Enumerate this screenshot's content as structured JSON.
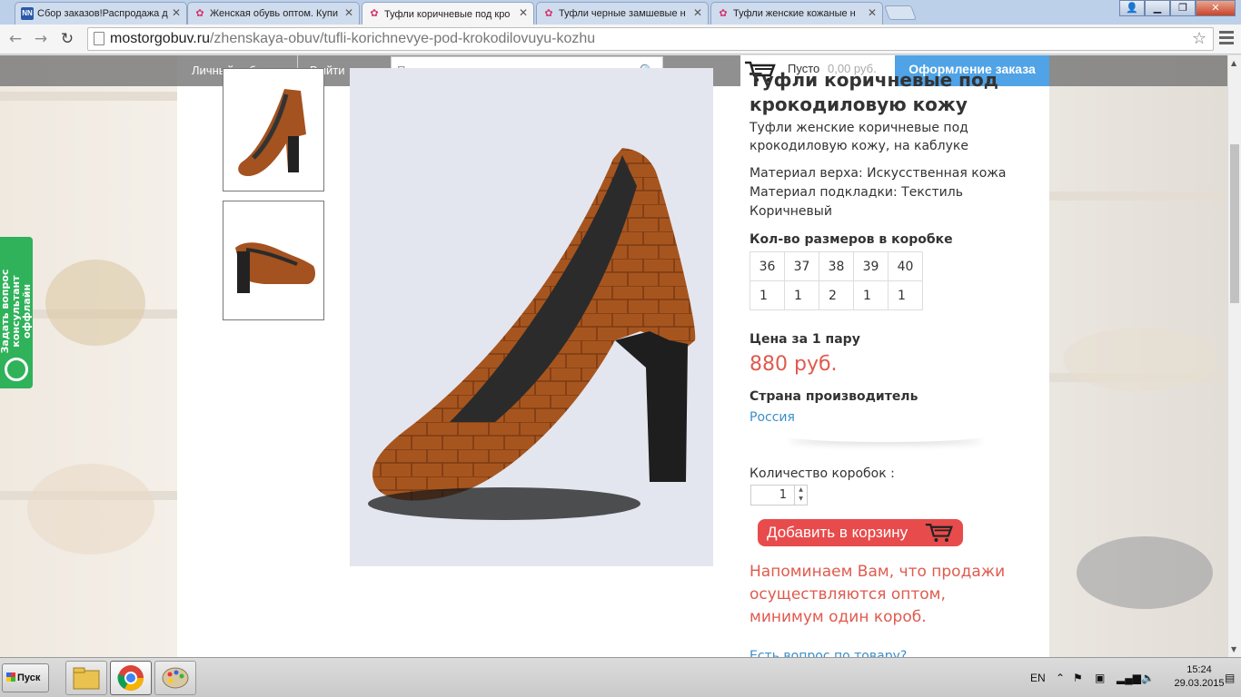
{
  "browser": {
    "tabs": [
      {
        "title": "Сбор заказов!Распродажа д",
        "favicon": "nn-icon",
        "active": false
      },
      {
        "title": "Женская обувь оптом. Купи",
        "favicon": "flower-icon",
        "active": false
      },
      {
        "title": "Туфли коричневые под кро",
        "favicon": "flower-icon",
        "active": true
      },
      {
        "title": "Туфли черные замшевые н",
        "favicon": "flower-icon",
        "active": false
      },
      {
        "title": "Туфли женские кожаные н",
        "favicon": "flower-icon",
        "active": false
      }
    ],
    "url_host": "mostorgobuv.ru",
    "url_path": "/zhenskaya-obuv/tufli-korichnevye-pod-krokodilovuyu-kozhu"
  },
  "header": {
    "account_link": "Личный кабинет",
    "logout_link": "Выйти",
    "search_placeholder": "Поиск",
    "cart_status": "Пусто",
    "cart_total": "0,00 руб.",
    "checkout_button": "Оформление заказа"
  },
  "product": {
    "title": "Туфли коричневые под крокодиловую кожу",
    "subtitle": "Туфли женские коричневые под крокодиловую кожу, на каблуке",
    "specs": [
      "Материал верха: Искусственная кожа",
      "Материал подкладки: Текстиль",
      "Коричневый"
    ],
    "sizes_label": "Кол-во размеров в коробке",
    "sizes": [
      "36",
      "37",
      "38",
      "39",
      "40"
    ],
    "size_counts": [
      "1",
      "1",
      "2",
      "1",
      "1"
    ],
    "price_label": "Цена за 1 пару",
    "price": "880 руб.",
    "country_label": "Страна производитель",
    "country": "Россия",
    "boxes_label": "Количество коробок :",
    "boxes_value": "1",
    "add_to_cart": "Добавить в корзину",
    "notice": "Напоминаем Вам, что продажи осуществляются оптом, минимум один короб.",
    "question_link": "Есть вопрос по товару?"
  },
  "side_widget": {
    "line1": "Задать вопрос",
    "line2": "консультант оффлайн"
  },
  "taskbar": {
    "start": "Пуск",
    "lang": "EN",
    "time": "15:24",
    "date": "29.03.2015"
  },
  "colors": {
    "accent_blue": "#4fa3e6",
    "price_red": "#e05a4e",
    "button_red": "#e84b4b",
    "link_blue": "#3a8fc9",
    "widget_green": "#2fb25a"
  }
}
